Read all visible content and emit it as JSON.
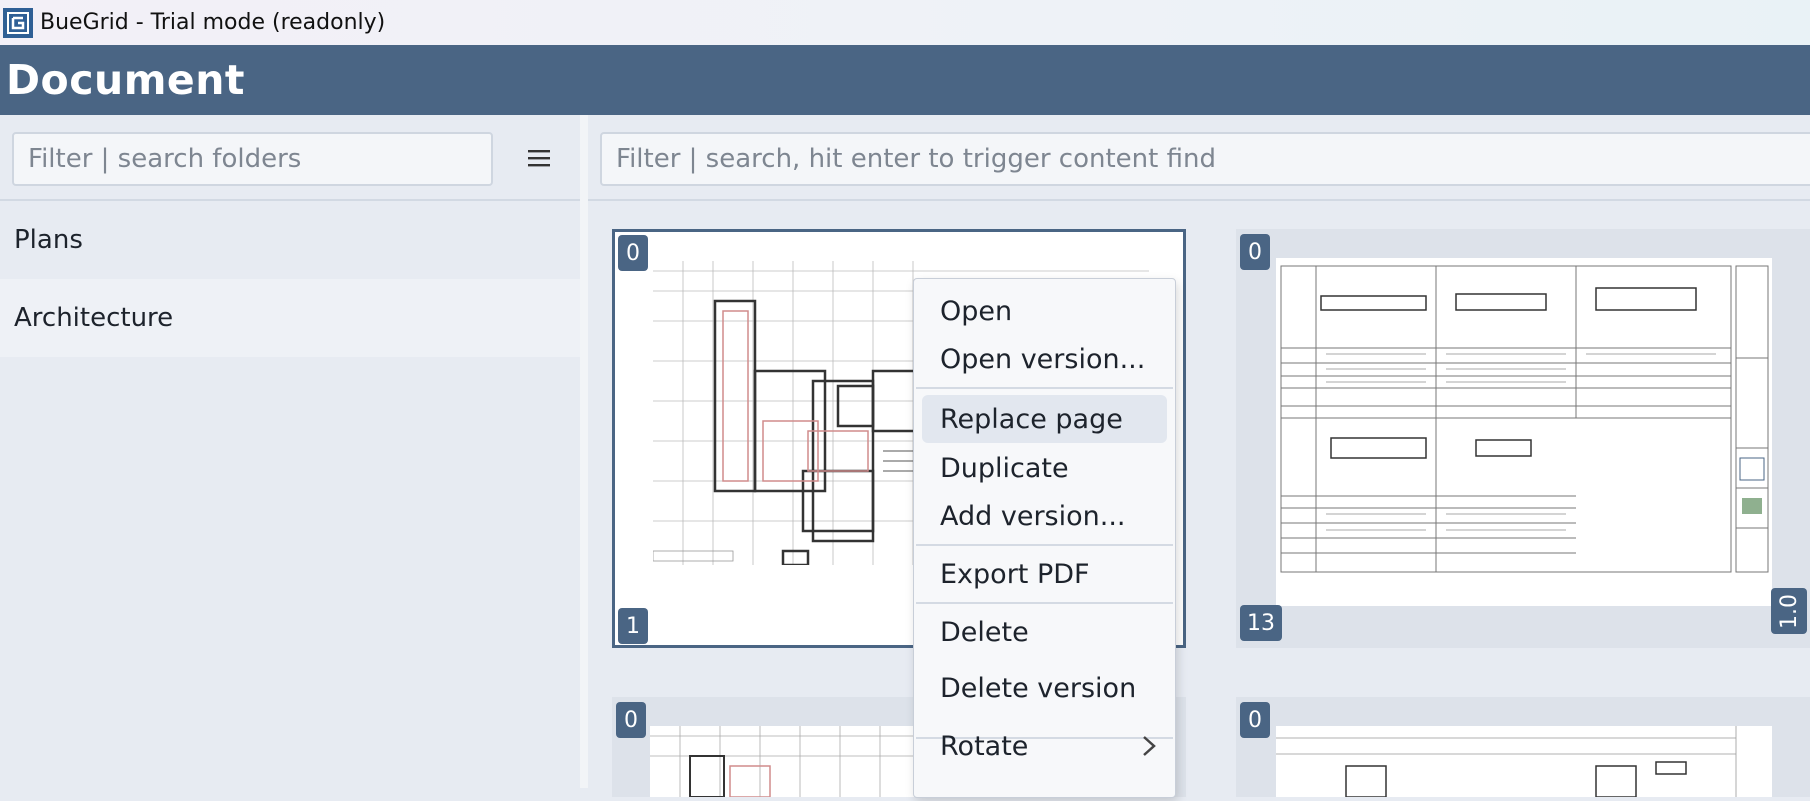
{
  "window": {
    "title": "BueGrid - Trial mode (readonly)"
  },
  "header": {
    "title": "Document"
  },
  "sidebar": {
    "search_placeholder": "Filter | search folders",
    "items": [
      {
        "label": "Plans"
      },
      {
        "label": "Architecture"
      }
    ]
  },
  "main": {
    "search_placeholder": "Filter | search, hit enter to trigger content find",
    "cards": [
      {
        "top_badge": "0",
        "page_badge": "1",
        "version": ""
      },
      {
        "top_badge": "0",
        "page_badge": "13",
        "version": "1.0"
      },
      {
        "top_badge": "0"
      },
      {
        "top_badge": "0"
      }
    ]
  },
  "context_menu": {
    "items": [
      {
        "label": "Open"
      },
      {
        "label": "Open version..."
      },
      {
        "label": "Replace page"
      },
      {
        "label": "Duplicate"
      },
      {
        "label": "Add version..."
      },
      {
        "label": "Export PDF"
      },
      {
        "label": "Delete"
      },
      {
        "label": "Delete version"
      },
      {
        "label": "Rotate"
      }
    ]
  },
  "colors": {
    "header_bg": "#4a6584",
    "badge_bg": "#4a6584",
    "sidebar_bg": "#e7ebf2",
    "logo_bg": "#2f5f95"
  },
  "icons": [
    "app-logo-icon",
    "hamburger-menu-icon",
    "chevron-right-icon"
  ]
}
